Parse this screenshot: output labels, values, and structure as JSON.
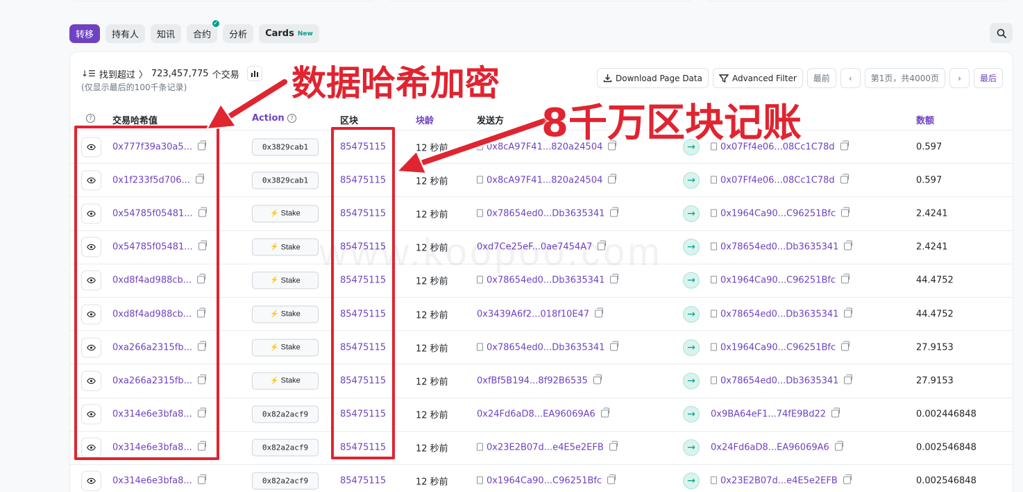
{
  "tabs": [
    {
      "label": "转移",
      "active": true
    },
    {
      "label": "持有人"
    },
    {
      "label": "知讯"
    },
    {
      "label": "合约",
      "verified": true
    },
    {
      "label": "分析"
    },
    {
      "label": "Cards",
      "badge": "New"
    }
  ],
  "summary": {
    "prefix": "找到超过",
    "count": "723,457,775",
    "suffix": "个交易",
    "note": "(仅显示最后的100千条记录)"
  },
  "toolbar": {
    "download": "Download Page Data",
    "filter": "Advanced Filter",
    "first": "最前",
    "page_info": "第1页，共4000页",
    "last": "最后"
  },
  "columns": {
    "hash": "交易哈希值",
    "action": "Action",
    "block": "区块",
    "age": "块龄",
    "from": "发送方",
    "amount": "数额"
  },
  "rows": [
    {
      "hash": "0x777f39a30a5...",
      "action": "0x3829cab1",
      "block": "85475115",
      "age": "12 秒前",
      "from": "0x8cA97F41...820a24504",
      "from_contract": true,
      "to": "0x07Ff4e06...08Cc1C78d",
      "to_contract": true,
      "amount": "0.597"
    },
    {
      "hash": "0x1f233f5d706...",
      "action": "0x3829cab1",
      "block": "85475115",
      "age": "12 秒前",
      "from": "0x8cA97F41...820a24504",
      "from_contract": true,
      "to": "0x07Ff4e06...08Cc1C78d",
      "to_contract": true,
      "amount": "0.597"
    },
    {
      "hash": "0x54785f05481...",
      "action": "Stake",
      "block": "85475115",
      "age": "12 秒前",
      "from": "0x78654ed0...Db3635341",
      "from_contract": true,
      "to": "0x1964Ca90...C96251Bfc",
      "to_contract": true,
      "amount": "2.4241"
    },
    {
      "hash": "0x54785f05481...",
      "action": "Stake",
      "block": "85475115",
      "age": "12 秒前",
      "from": "0xd7Ce25eF...0ae7454A7",
      "from_contract": false,
      "to": "0x78654ed0...Db3635341",
      "to_contract": true,
      "amount": "2.4241"
    },
    {
      "hash": "0xd8f4ad988cb...",
      "action": "Stake",
      "block": "85475115",
      "age": "12 秒前",
      "from": "0x78654ed0...Db3635341",
      "from_contract": true,
      "to": "0x1964Ca90...C96251Bfc",
      "to_contract": true,
      "amount": "44.4752"
    },
    {
      "hash": "0xd8f4ad988cb...",
      "action": "Stake",
      "block": "85475115",
      "age": "12 秒前",
      "from": "0x3439A6f2...018f10E47",
      "from_contract": false,
      "to": "0x78654ed0...Db3635341",
      "to_contract": true,
      "amount": "44.4752"
    },
    {
      "hash": "0xa266a2315fb...",
      "action": "Stake",
      "block": "85475115",
      "age": "12 秒前",
      "from": "0x78654ed0...Db3635341",
      "from_contract": true,
      "to": "0x1964Ca90...C96251Bfc",
      "to_contract": true,
      "amount": "27.9153"
    },
    {
      "hash": "0xa266a2315fb...",
      "action": "Stake",
      "block": "85475115",
      "age": "12 秒前",
      "from": "0xfBf5B194...8f92B6535",
      "from_contract": false,
      "to": "0x78654ed0...Db3635341",
      "to_contract": true,
      "amount": "27.9153"
    },
    {
      "hash": "0x314e6e3bfa8...",
      "action": "0x82a2acf9",
      "block": "85475115",
      "age": "12 秒前",
      "from": "0x24Fd6aD8...EA96069A6",
      "from_contract": false,
      "to": "0x9BA64eF1...74fE9Bd22",
      "to_contract": false,
      "amount": "0.002446848"
    },
    {
      "hash": "0x314e6e3bfa8...",
      "action": "0x82a2acf9",
      "block": "85475115",
      "age": "12 秒前",
      "from": "0x23E2B07d...e4E5e2EFB",
      "from_contract": true,
      "to": "0x24Fd6aD8...EA96069A6",
      "to_contract": false,
      "amount": "0.002546848"
    },
    {
      "hash": "0x314e6e3bfa8...",
      "action": "0x82a2acf9",
      "block": "85475115",
      "age": "12 秒前",
      "from": "0x1964Ca90...C96251Bfc",
      "from_contract": true,
      "to": "0x23E2B07d...e4E5e2EFB",
      "to_contract": true,
      "amount": "0.002546848"
    }
  ],
  "annotations": {
    "hash_label": "数据哈希加密",
    "block_label": "8千万区块记账"
  },
  "watermark": "www.koopoo.com",
  "colors": {
    "accent": "#6f42c1",
    "green": "#00a186",
    "annotation": "#e02430"
  }
}
